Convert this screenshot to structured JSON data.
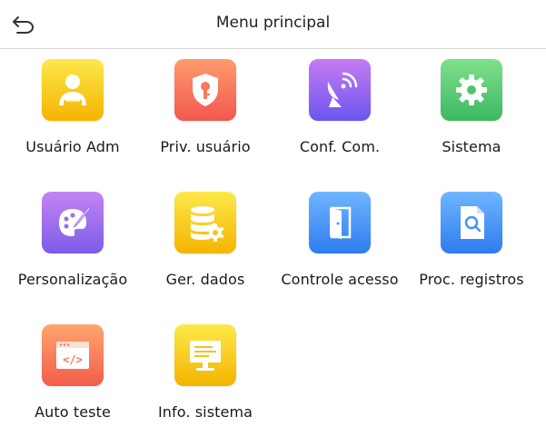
{
  "header": {
    "title": "Menu principal",
    "back_icon": "back-arrow-icon"
  },
  "tiles": [
    {
      "label": "Usuário Adm",
      "icon": "admin-user-icon",
      "color_top": "#fde84a",
      "color_bottom": "#f4b400"
    },
    {
      "label": "Priv. usuário",
      "icon": "privilege-shield-icon",
      "color_top": "#ff9a6e",
      "color_bottom": "#f2584f"
    },
    {
      "label": "Conf. Com.",
      "icon": "satellite-dish-icon",
      "color_top": "#c67cf4",
      "color_bottom": "#6c56ee"
    },
    {
      "label": "Sistema",
      "icon": "gear-icon",
      "color_top": "#7fe08c",
      "color_bottom": "#3cb862"
    },
    {
      "label": "Personalização",
      "icon": "palette-icon",
      "color_top": "#c484f3",
      "color_bottom": "#7a5ce8"
    },
    {
      "label": "Ger. dados",
      "icon": "database-gear-icon",
      "color_top": "#fde84a",
      "color_bottom": "#f4b400"
    },
    {
      "label": "Controle acesso",
      "icon": "door-icon",
      "color_top": "#6fb5ff",
      "color_bottom": "#2e7cf0"
    },
    {
      "label": "Proc. registros",
      "icon": "document-search-icon",
      "color_top": "#6fb5ff",
      "color_bottom": "#2e7cf0"
    },
    {
      "label": "Auto teste",
      "icon": "code-window-icon",
      "color_top": "#ffa56e",
      "color_bottom": "#f25c4c"
    },
    {
      "label": "Info. sistema",
      "icon": "monitor-icon",
      "color_top": "#fde84a",
      "color_bottom": "#f4b400"
    }
  ]
}
